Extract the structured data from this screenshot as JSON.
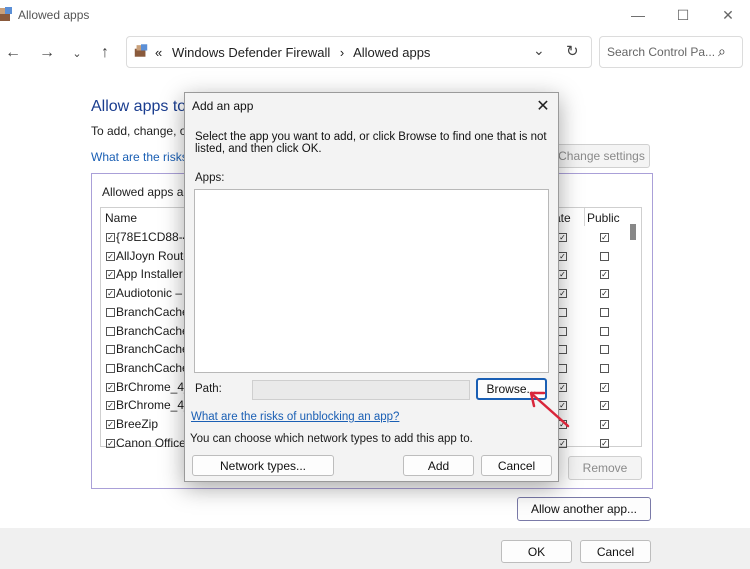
{
  "window": {
    "title": "Allowed apps",
    "controls": {
      "minimize": "—",
      "maximize": "☐",
      "close": "✕"
    }
  },
  "nav": {
    "back": "←",
    "forward": "→",
    "recent": "⌄",
    "up": "↑",
    "address": {
      "separator": "«",
      "path": [
        "Windows Defender Firewall",
        "Allowed apps"
      ],
      "chevron": "›"
    },
    "dropdown": "⌄",
    "refresh": "↻",
    "search_placeholder": "Search Control Pa...",
    "search_icon": "⌕"
  },
  "main": {
    "heading": "Allow apps to",
    "description": "To add, change, or",
    "risks_link": "What are the risks",
    "change_settings": "Change settings",
    "group_label": "Allowed apps ar",
    "columns": {
      "name": "Name",
      "private": "ate",
      "public": "Public"
    },
    "rows": [
      {
        "name": "{78E1CD88-4",
        "checked": true,
        "private": true,
        "public": true
      },
      {
        "name": "AllJoyn Route",
        "checked": true,
        "private": true,
        "public": false
      },
      {
        "name": "App Installer",
        "checked": true,
        "private": true,
        "public": true
      },
      {
        "name": "Audiotonic –",
        "checked": true,
        "private": true,
        "public": true
      },
      {
        "name": "BranchCache",
        "checked": false,
        "private": false,
        "public": false
      },
      {
        "name": "BranchCache",
        "checked": false,
        "private": false,
        "public": false
      },
      {
        "name": "BranchCache",
        "checked": false,
        "private": false,
        "public": false
      },
      {
        "name": "BranchCache",
        "checked": false,
        "private": false,
        "public": false
      },
      {
        "name": "BrChrome_4_",
        "checked": true,
        "private": true,
        "public": true
      },
      {
        "name": "BrChrome_4_",
        "checked": true,
        "private": true,
        "public": true
      },
      {
        "name": "BreeZip",
        "checked": true,
        "private": true,
        "public": true
      },
      {
        "name": "Canon Office",
        "checked": true,
        "private": true,
        "public": true
      }
    ],
    "remove": "Remove",
    "allow_another": "Allow another app..."
  },
  "footer": {
    "ok": "OK",
    "cancel": "Cancel"
  },
  "dialog": {
    "title": "Add an app",
    "close": "✕",
    "instruction": "Select the app you want to add, or click Browse to find one that is not listed, and then click OK.",
    "apps_label": "Apps:",
    "path_label": "Path:",
    "browse": "Browse...",
    "risks_link": "What are the risks of unblocking an app?",
    "network_note": "You can choose which network types to add this app to.",
    "network_types": "Network types...",
    "add": "Add",
    "cancel": "Cancel"
  },
  "colors": {
    "accent_link": "#1a5fb4",
    "annotation_arrow": "#d9263a"
  }
}
